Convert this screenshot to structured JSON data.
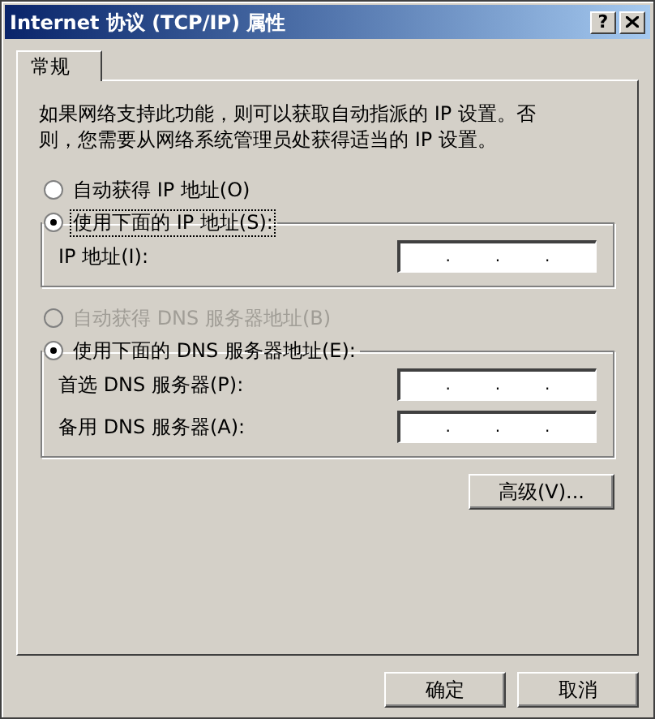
{
  "window": {
    "title": "Internet 协议 (TCP/IP) 属性",
    "help_button": "?"
  },
  "tabs": [
    {
      "label": "常规",
      "selected": true
    }
  ],
  "description": "如果网络支持此功能，则可以获取自动指派的 IP 设置。否则，您需要从网络系统管理员处获得适当的 IP 设置。",
  "ip_section": {
    "auto_option": {
      "label": "自动获得 IP 地址(O)",
      "selected": false,
      "disabled": false
    },
    "manual_option": {
      "label": "使用下面的 IP 地址(S):",
      "selected": true,
      "disabled": false,
      "focused": true
    },
    "fields": [
      {
        "label": "IP 地址(I):",
        "separators": [
          ".",
          ".",
          "."
        ]
      }
    ]
  },
  "dns_section": {
    "auto_option": {
      "label": "自动获得 DNS 服务器地址(B)",
      "selected": false,
      "disabled": true
    },
    "manual_option": {
      "label": "使用下面的 DNS 服务器地址(E):",
      "selected": true,
      "disabled": false,
      "focused": false
    },
    "fields": [
      {
        "label": "首选 DNS 服务器(P):",
        "separators": [
          ".",
          ".",
          "."
        ]
      },
      {
        "label": "备用 DNS 服务器(A):",
        "separators": [
          ".",
          ".",
          "."
        ]
      }
    ]
  },
  "advanced_button": "高级(V)...",
  "buttons": [
    "确定",
    "取消"
  ]
}
